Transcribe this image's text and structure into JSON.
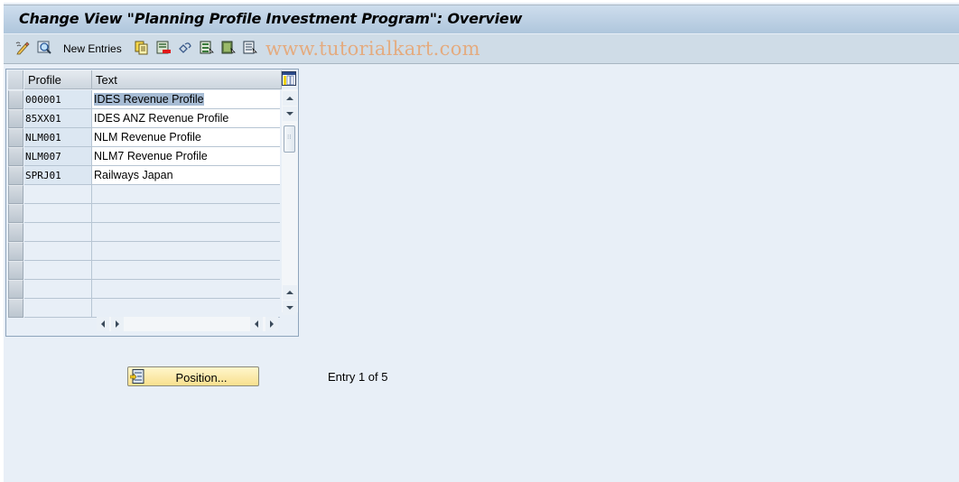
{
  "window": {
    "title": "Change View \"Planning Profile Investment Program\": Overview"
  },
  "toolbar": {
    "items": [
      {
        "name": "display-change-icon",
        "label": ""
      },
      {
        "name": "details-icon",
        "label": ""
      },
      {
        "name": "new-entries",
        "label": "New Entries"
      },
      {
        "name": "copy-as-icon",
        "label": ""
      },
      {
        "name": "delete-icon",
        "label": ""
      },
      {
        "name": "undo-change-icon",
        "label": ""
      },
      {
        "name": "select-all-icon",
        "label": ""
      },
      {
        "name": "select-block-icon",
        "label": ""
      },
      {
        "name": "deselect-all-icon",
        "label": ""
      }
    ],
    "new_entries_label": "New Entries",
    "watermark": "www.tutorialkart.com"
  },
  "table": {
    "columns": [
      "Profile",
      "Text"
    ],
    "rows": [
      {
        "profile": "000001",
        "text": "IDES Revenue Profile",
        "selected_text": true
      },
      {
        "profile": "85XX01",
        "text": "IDES ANZ Revenue Profile"
      },
      {
        "profile": "NLM001",
        "text": "NLM Revenue Profile"
      },
      {
        "profile": "NLM007",
        "text": "NLM7 Revenue Profile"
      },
      {
        "profile": "SPRJ01",
        "text": "Railways Japan"
      }
    ],
    "empty_rows": 7
  },
  "footer": {
    "position_button": "Position...",
    "entry_status": "Entry 1 of 5"
  },
  "colors": {
    "background": "#e8eff7",
    "title_bar": "#afc6dc",
    "toolbar": "#cfdce7",
    "button": "#f8e08e",
    "selection": "#a7bcd4"
  }
}
